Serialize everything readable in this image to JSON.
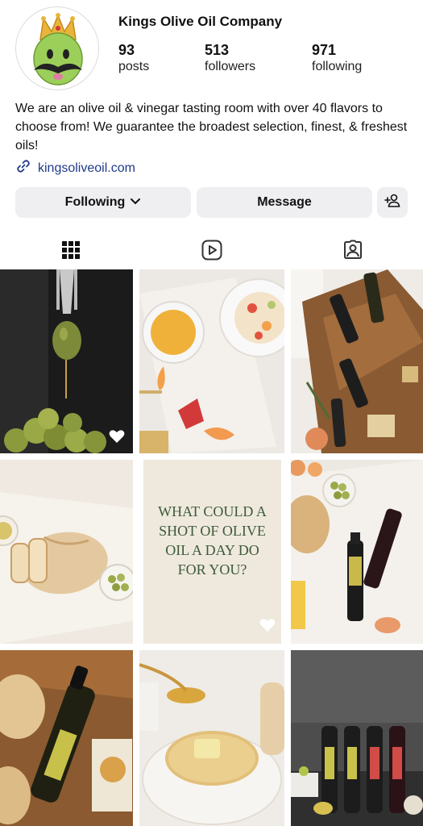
{
  "profile": {
    "name": "Kings Olive Oil Company",
    "stats": [
      {
        "value": "93",
        "label": "posts"
      },
      {
        "value": "513",
        "label": "followers"
      },
      {
        "value": "971",
        "label": "following"
      }
    ],
    "bio": "We are an olive oil & vinegar tasting room with over 40 flavors to choose from! We guarantee the broadest selection, finest, & freshest oils!",
    "link": "kingsoliveoil.com"
  },
  "actions": {
    "following_label": "Following",
    "message_label": "Message"
  },
  "tabs": [
    {
      "icon": "grid-icon",
      "active": true
    },
    {
      "icon": "reels-icon",
      "active": false
    },
    {
      "icon": "tagged-icon",
      "active": false
    }
  ],
  "posts": [
    {
      "id": 1,
      "desc": "olive dripping oil from fork",
      "liked_indicator": true
    },
    {
      "id": 2,
      "desc": "honey bowl, strawberry, salad plate"
    },
    {
      "id": 3,
      "desc": "oil bottles on wooden board"
    },
    {
      "id": 4,
      "desc": "sliced bread with olives"
    },
    {
      "id": 5,
      "text": "WHAT COULD A SHOT OF OLIVE OIL A DAY DO FOR YOU?",
      "liked_indicator": true
    },
    {
      "id": 6,
      "desc": "bread, peaches and two bottles"
    },
    {
      "id": 7,
      "desc": "bottle with bread and garlic"
    },
    {
      "id": 8,
      "desc": "spoon pouring oil on bread"
    },
    {
      "id": 9,
      "desc": "four bottles lineup"
    }
  ],
  "colors": {
    "link": "#1f3a8a",
    "button_bg": "#efeff2",
    "poster_bg": "#efe9dd",
    "poster_text": "#3d5a3a"
  }
}
